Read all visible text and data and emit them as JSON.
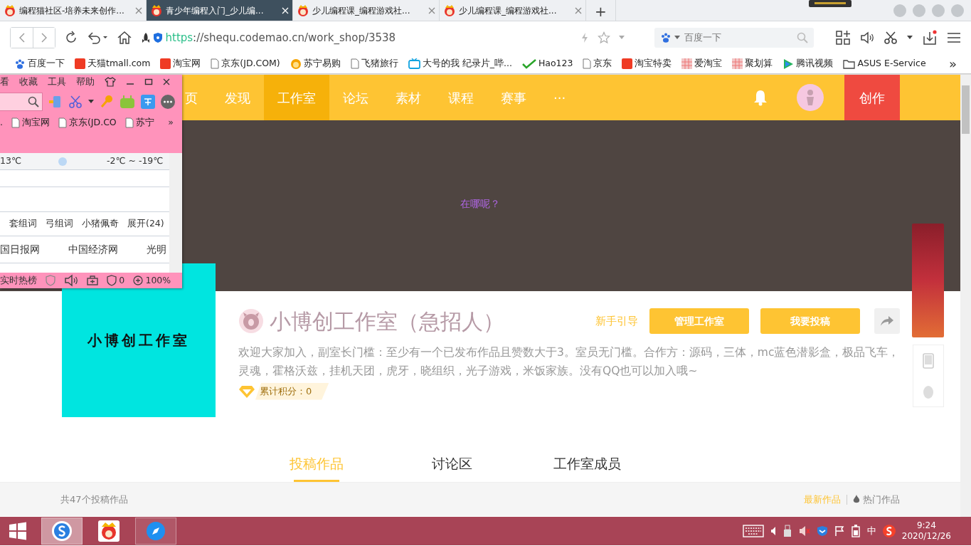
{
  "browser_tabs": [
    {
      "title": "编程猫社区-培养未来创作...",
      "selected": false
    },
    {
      "title": "青少年编程入门_少儿编...",
      "selected": true
    },
    {
      "title": "少儿编程课_编程游戏社...",
      "selected": false
    },
    {
      "title": "少儿编程课_编程游戏社...",
      "selected": false
    }
  ],
  "new_tab": "+",
  "address_bar": {
    "scheme": "https",
    "rest": "://shequ.codemao.cn/work_shop/3538"
  },
  "search_box": {
    "placeholder": "百度一下"
  },
  "bookmarks": [
    {
      "label": "百度一下",
      "kind": "paw"
    },
    {
      "label": "天猫tmall.com",
      "kind": "logo"
    },
    {
      "label": "淘宝网",
      "kind": "logo"
    },
    {
      "label": "京东(JD.COM)",
      "kind": "page"
    },
    {
      "label": "苏宁易购",
      "kind": "face"
    },
    {
      "label": "飞猪旅行",
      "kind": "page"
    },
    {
      "label": "大号的我 纪录片_哔...",
      "kind": "tv"
    },
    {
      "label": "Hao123",
      "kind": "check"
    },
    {
      "label": "京东",
      "kind": "page"
    },
    {
      "label": "淘宝特卖",
      "kind": "logo"
    },
    {
      "label": "爱淘宝",
      "kind": "pattern"
    },
    {
      "label": "聚划算",
      "kind": "pattern"
    },
    {
      "label": "腾讯视频",
      "kind": "play"
    },
    {
      "label": "ASUS E-Service",
      "kind": "folder"
    }
  ],
  "bookmarks_more": "»",
  "mini_window": {
    "menu": [
      "看",
      "收藏",
      "工具",
      "帮助"
    ],
    "bookmarks": [
      {
        "label": ".",
        "kind": "none"
      },
      {
        "label": "淘宝网",
        "kind": "page"
      },
      {
        "label": "京东(JD.CO",
        "kind": "page"
      },
      {
        "label": "苏宁",
        "kind": "page"
      }
    ],
    "bookmarks_more": "»",
    "weather": [
      "13℃",
      "-2℃ ~ -19℃"
    ],
    "words": [
      "套组词",
      "弓组词",
      "小猪佩奇",
      "展开(24)"
    ],
    "sites": [
      "国日报网",
      "中国经济网",
      "光明"
    ],
    "status": {
      "hot": "实时热榜",
      "ads": "0",
      "zoom": "100%"
    }
  },
  "site_nav": {
    "items": [
      {
        "label": "页",
        "selected": false
      },
      {
        "label": "发现",
        "selected": false
      },
      {
        "label": "工作室",
        "selected": true
      },
      {
        "label": "论坛",
        "selected": false
      },
      {
        "label": "素材",
        "selected": false
      },
      {
        "label": "课程",
        "selected": false
      },
      {
        "label": "赛事",
        "selected": false
      },
      {
        "label": "···",
        "selected": false
      }
    ],
    "create_button": "创作"
  },
  "banner": {
    "text": "在哪呢？"
  },
  "studio": {
    "cover_text": "小博创工作室",
    "name": "小博创工作室（急招人）",
    "guide": "新手引导",
    "buttons": [
      "管理工作室",
      "我要投稿"
    ],
    "description": "欢迎大家加入，副室长门槛：至少有一个已发布作品且赞数大于3。室员无门槛。合作方：源码，三体，mc蓝色潜影盒，极品飞车，灵魂，霍格沃兹，挂机天团，虎牙，晓组织，光子游戏，米饭家族。没有QQ也可以加入哦~",
    "score": "累计积分：0"
  },
  "content_tabs": [
    {
      "label": "投稿作品",
      "selected": true
    },
    {
      "label": "讨论区",
      "selected": false
    },
    {
      "label": "工作室成员",
      "selected": false
    }
  ],
  "works_bar": {
    "count": "共47个投稿作品",
    "sorts": [
      {
        "label": "最新作品",
        "selected": true
      },
      {
        "label": "热门作品",
        "selected": false
      }
    ]
  },
  "taskbar": {
    "ime": "中",
    "time": "9:24",
    "date": "2020/12/26"
  }
}
